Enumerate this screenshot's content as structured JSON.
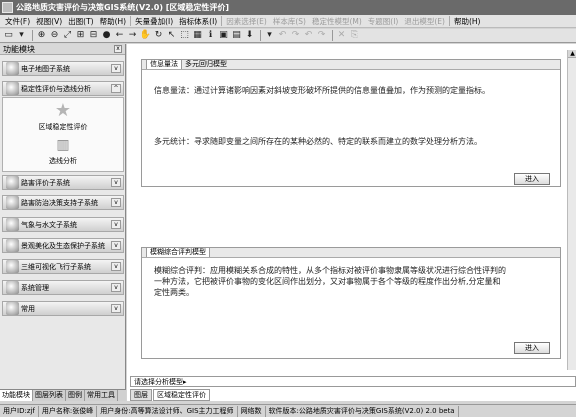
{
  "title": "公路地质灾害评价与决策GIS系统(V2.0) [区域稳定性评价]",
  "menu": [
    {
      "label": "文件(F)",
      "disabled": false
    },
    {
      "label": "视图(V)",
      "disabled": false
    },
    {
      "label": "出图(T)",
      "disabled": false
    },
    {
      "label": "帮助(H)",
      "disabled": false
    },
    {
      "label": "矢量叠加(I)",
      "disabled": false
    },
    {
      "label": "指标体系(I)",
      "disabled": false
    },
    {
      "label": "因素选择(E)",
      "disabled": true
    },
    {
      "label": "样本库(S)",
      "disabled": true
    },
    {
      "label": "稳定性模型(M)",
      "disabled": true
    },
    {
      "label": "专题图(I)",
      "disabled": true
    },
    {
      "label": "退出模型(E)",
      "disabled": true
    },
    {
      "label": "帮助(H)",
      "disabled": false
    }
  ],
  "toolbar": {
    "icons": [
      "open-icon",
      "dropdown-icon",
      "zoom-in-icon",
      "zoom-out-icon",
      "full-extent-icon",
      "fixed-zoom-in-icon",
      "fixed-zoom-out-icon",
      "globe-icon",
      "back-arrow-icon",
      "forward-arrow-icon",
      "pan-hand-icon",
      "refresh-icon",
      "select-arrow-icon",
      "select-box-icon",
      "table-icon",
      "info-icon",
      "measure-icon",
      "layer-icon",
      "identify-icon",
      "dropdown-icon",
      "undo-icon",
      "redo-icon",
      "undo-all-icon",
      "redo-all-icon",
      "delete-icon",
      "copy-icon"
    ],
    "glyphs": [
      "▭",
      "▾",
      "⊕",
      "⊖",
      "⤢",
      "⊞",
      "⊟",
      "●",
      "←",
      "→",
      "✋",
      "↻",
      "↖",
      "⬚",
      "▦",
      "ℹ",
      "▣",
      "▤",
      "⬇",
      "▾",
      "↶",
      "↷",
      "↶",
      "↷",
      "✕",
      "⎘"
    ]
  },
  "sidebar": {
    "header": "功能模块",
    "close_label": "x",
    "groups": [
      {
        "label": "电子地图子系统",
        "icon": "map-module-icon"
      },
      {
        "label": "稳定性评价与选线分析",
        "icon": "stability-module-icon"
      },
      {
        "label": "路害评价子系统",
        "icon": "hazard-module-icon"
      },
      {
        "label": "路害防治决策支持子系统",
        "icon": "decision-module-icon"
      },
      {
        "label": "气象与水文子系统",
        "icon": "weather-module-icon"
      },
      {
        "label": "景观美化及生态保护子系统",
        "icon": "landscape-module-icon"
      },
      {
        "label": "三维可视化飞行子系统",
        "icon": "3d-module-icon"
      },
      {
        "label": "系统管理",
        "icon": "admin-module-icon"
      },
      {
        "label": "常用",
        "icon": "common-module-icon"
      }
    ],
    "items": [
      {
        "label": "区域稳定性评价",
        "icon": "star-icon"
      },
      {
        "label": "选线分析",
        "icon": "route-icon"
      }
    ],
    "tabs": [
      "功能模块",
      "图层列表",
      "图例",
      "常用工具"
    ]
  },
  "main": {
    "panel1": {
      "tabs": [
        "信息量法",
        "多元回归模型"
      ],
      "para1": "信息量法：通过计算诸影响因素对斜坡变形破坏所提供的信息量值叠加，作为预测的定量指标。",
      "para2": "多元统计：寻求随即变量之间所存在的某种必然的、特定的联系而建立的数学处理分析方法。",
      "button": "进入"
    },
    "panel2": {
      "tabs": [
        "模糊综合评判模型"
      ],
      "para": "模糊综合评判：应用模糊关系合成的特性，从多个指标对被评价事物隶属等级状况进行综合性评判的一种方法，它把被评价事物的变化区间作出划分，又对事物属于各个等级的程度作出分析,分定量和定性两类。",
      "button": "进入"
    },
    "combo": "请选择分析模型▸",
    "tabs": [
      "图层",
      "区域稳定性评价"
    ]
  },
  "status": [
    "用户ID:zjf",
    "用户名称:张俊峰",
    "用户身份:高等算法设计师、GIS主力工程师",
    "网络数",
    "软件版本:公路地质灾害评价与决策GIS系统(V2.0) 2.0 beta"
  ]
}
